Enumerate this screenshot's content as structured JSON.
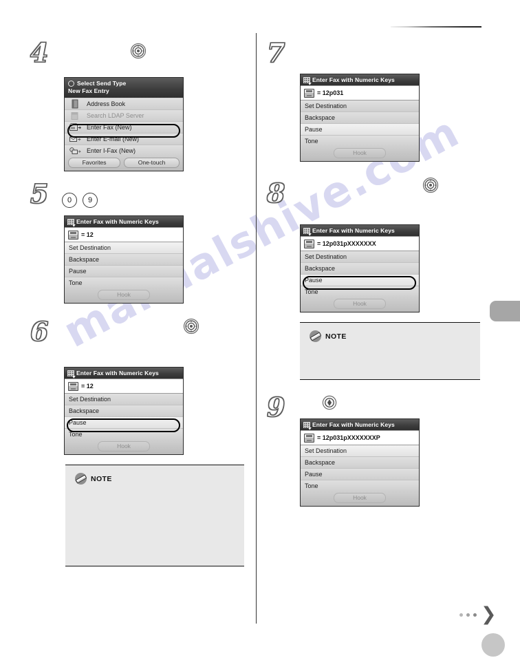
{
  "page": {
    "watermark": "manualshive.com",
    "side_tab_color": "#a6a6a6",
    "accent_color": "#2b2b2b"
  },
  "steps": [
    {
      "number": "4",
      "keys": [
        "ok-key"
      ],
      "screen": {
        "title_line1": "Select Send Type",
        "title_line2": "New Fax Entry",
        "title_icon": "circle-icon",
        "rows": [
          {
            "label": "Address Book",
            "icon": "address-book-icon",
            "state": "normal"
          },
          {
            "label": "Search LDAP Server",
            "icon": "ldap-server-icon",
            "state": "dim"
          },
          {
            "label": "Enter Fax (New)",
            "icon": "fax-icon",
            "state": "selected"
          },
          {
            "label": "Enter E-mail (New)",
            "icon": "email-icon",
            "state": "normal"
          },
          {
            "label": "Enter I-Fax (New)",
            "icon": "ifax-icon",
            "state": "normal"
          }
        ],
        "footer_buttons": [
          "Favorites",
          "One-touch"
        ]
      }
    },
    {
      "number": "5",
      "keys": [
        "0",
        "9"
      ],
      "screen": {
        "title": "Enter Fax with Numeric Keys",
        "title_icon": "numeric-keys-icon",
        "field_value": "= 12",
        "rows": [
          {
            "label": "Set Destination",
            "state": "highlight"
          },
          {
            "label": "Backspace",
            "state": "normal"
          },
          {
            "label": "Pause",
            "state": "normal"
          },
          {
            "label": "Tone",
            "state": "normal"
          }
        ],
        "footer_button": "Hook"
      }
    },
    {
      "number": "6",
      "keys": [
        "ok-key"
      ],
      "screen": {
        "title": "Enter Fax with Numeric Keys",
        "title_icon": "numeric-keys-icon",
        "field_value": "= 12",
        "rows": [
          {
            "label": "Set Destination",
            "state": "normal"
          },
          {
            "label": "Backspace",
            "state": "normal"
          },
          {
            "label": "Pause",
            "state": "selected"
          },
          {
            "label": "Tone",
            "state": "normal"
          }
        ],
        "footer_button": "Hook"
      }
    },
    {
      "number": "7",
      "keys": [],
      "screen": {
        "title": "Enter Fax with Numeric Keys",
        "title_icon": "numeric-keys-icon",
        "field_value": "= 12p031",
        "rows": [
          {
            "label": "Set Destination",
            "state": "normal"
          },
          {
            "label": "Backspace",
            "state": "normal"
          },
          {
            "label": "Pause",
            "state": "highlight"
          },
          {
            "label": "Tone",
            "state": "normal"
          }
        ],
        "footer_button": "Hook"
      }
    },
    {
      "number": "8",
      "keys": [
        "ok-key"
      ],
      "screen": {
        "title": "Enter Fax with Numeric Keys",
        "title_icon": "numeric-keys-icon",
        "field_value": "= 12p031pXXXXXXX",
        "rows": [
          {
            "label": "Set Destination",
            "state": "normal"
          },
          {
            "label": "Backspace",
            "state": "normal"
          },
          {
            "label": "Pause",
            "state": "selected"
          },
          {
            "label": "Tone",
            "state": "normal"
          }
        ],
        "footer_button": "Hook"
      }
    },
    {
      "number": "9",
      "keys": [
        "start-key"
      ],
      "screen": {
        "title": "Enter Fax with Numeric Keys",
        "title_icon": "numeric-keys-icon",
        "field_value": "= 12p031pXXXXXXXP",
        "rows": [
          {
            "label": "Set Destination",
            "state": "highlight"
          },
          {
            "label": "Backspace",
            "state": "normal"
          },
          {
            "label": "Pause",
            "state": "normal"
          },
          {
            "label": "Tone",
            "state": "normal"
          }
        ],
        "footer_button": "Hook"
      }
    }
  ],
  "notes": [
    {
      "label": "NOTE",
      "body": ""
    },
    {
      "label": "NOTE",
      "body": ""
    }
  ]
}
